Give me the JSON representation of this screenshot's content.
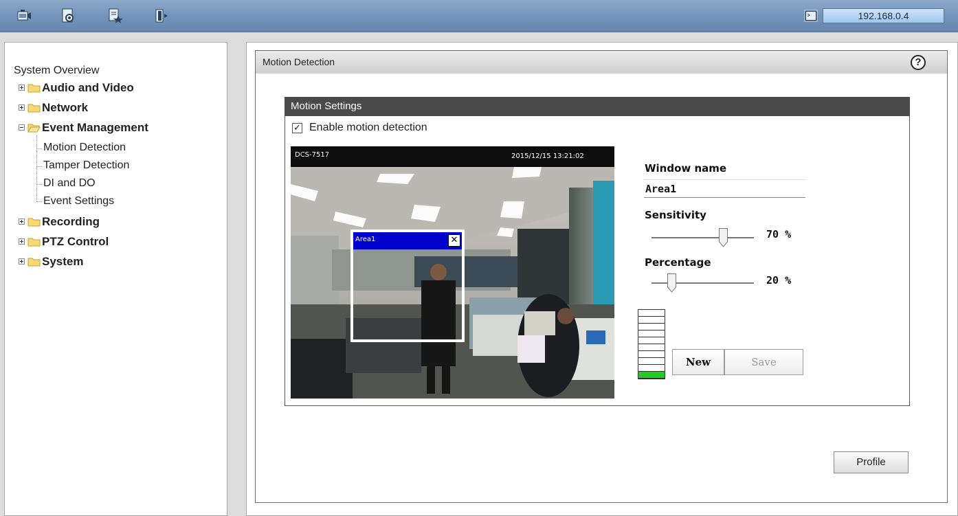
{
  "toolbar": {
    "icons": [
      "camera-icon",
      "settings-icon",
      "favorites-icon",
      "logout-icon"
    ],
    "ip_address": "192.168.0.4"
  },
  "sidebar": {
    "overview": "System Overview",
    "items": [
      {
        "label": "Audio and Video",
        "expanded": false
      },
      {
        "label": "Network",
        "expanded": false
      },
      {
        "label": "Event Management",
        "expanded": true,
        "children": [
          "Motion Detection",
          "Tamper Detection",
          "DI and DO",
          "Event Settings"
        ]
      },
      {
        "label": "Recording",
        "expanded": false
      },
      {
        "label": "PTZ Control",
        "expanded": false
      },
      {
        "label": "System",
        "expanded": false
      }
    ]
  },
  "panel": {
    "title": "Motion Detection",
    "help": "?"
  },
  "settings": {
    "title": "Motion Settings",
    "enable_label": "Enable motion detection",
    "enabled": true,
    "video": {
      "camera_name": "DCS-7517",
      "timestamp": "2015/12/15 13:21:02",
      "window_label": "Area1",
      "close": "✕"
    },
    "window_name_label": "Window name",
    "window_name_value": "Area1",
    "sensitivity_label": "Sensitivity",
    "sensitivity_value": 70,
    "sensitivity_text": "70 %",
    "percentage_label": "Percentage",
    "percentage_value": 20,
    "percentage_text": "20 %",
    "activity_level": 0.1,
    "new_label": "New",
    "save_label": "Save"
  },
  "profile_label": "Profile",
  "colors": {
    "toolbar": "#7395bb",
    "header_dark": "#4a4a4a",
    "window_title": "#0000cc",
    "meter_green": "#22cc22"
  }
}
